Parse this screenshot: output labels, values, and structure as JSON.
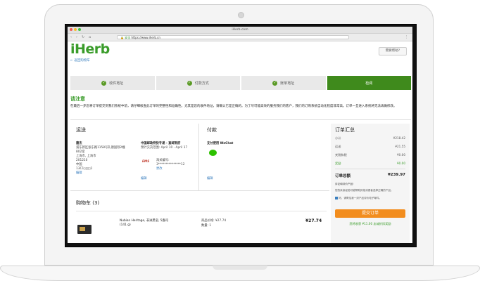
{
  "browser": {
    "tab_title": "iHerb.com",
    "url_secure": "安全",
    "url": "https://www.iherb.cn"
  },
  "header": {
    "logo": "iHerb",
    "back_link": "← 返回购物车",
    "help_button": "需要帮助?"
  },
  "steps": [
    {
      "label": "收件地址",
      "done": true
    },
    {
      "label": "付款方式",
      "done": true
    },
    {
      "label": "账单地址",
      "done": true
    },
    {
      "label": "检阅",
      "done": false
    }
  ],
  "notice": {
    "title": "请注意",
    "text": "在最后一步您将订单提交到我们系统中前，请仔细核查此订单的完整性和准确性。尤其是您的收件地址，请确认它是正确的。为了尽可能高效的服务我们的客户，我们的订购系统自动化程度非常高。订单一旦进入系统将无法再做修改。"
  },
  "shipping": {
    "title": "运送",
    "name": "唐杰",
    "address_lines": [
      "浦东新区张东路1158号礼德国际2幢",
      "802室",
      "上海市, 上海市",
      "201210",
      "中国",
      "13C1▯▯▯▯1"
    ],
    "edit": "编辑",
    "carrier": "中国邮政特快专递 - 直邮到府",
    "eta": "预计交货范围: April 10 - April 17",
    "customs_label": "海关编号:",
    "customs_value": "3***************12",
    "change": "更改",
    "edit2": "编辑",
    "ems": "EMS"
  },
  "payment": {
    "title": "付款",
    "method": "支付使用 WeChat",
    "edit": "编辑"
  },
  "summary": {
    "title": "订单汇总",
    "rows": [
      {
        "label": "小计",
        "value": "¥218.42"
      },
      {
        "label": "运送",
        "value": "¥21.55"
      },
      {
        "label": "关税和税",
        "value": "¥0.00"
      },
      {
        "label": "奖励",
        "value": "¥0.00"
      }
    ],
    "total_label": "订单总额",
    "total_value": "¥239.97",
    "review_title": "评论和评价产品!",
    "review_text": "您的亲身经验可能帮助其他消费者选择正确的产品。",
    "checkbox_text": "好。请寄给我一封产品评价电子邮件。",
    "submit": "提交订单",
    "reward": "您将收获 ¥11.00 忠诚折扣奖励"
  },
  "cart": {
    "title": "购物车 (3)",
    "items": [
      {
        "name": "Nubian Heritage, 非洲黑皂, 5盎司 (141 g)",
        "price_label": "商品价格:",
        "price": "¥27.74",
        "qty_label": "数量:",
        "qty": "1",
        "line_total": "¥27.74"
      }
    ]
  },
  "colors": {
    "brand_green": "#3a9c2a",
    "active_step": "#3f8a1c",
    "submit_orange": "#f28d1e",
    "link_blue": "#3a7fbf"
  }
}
